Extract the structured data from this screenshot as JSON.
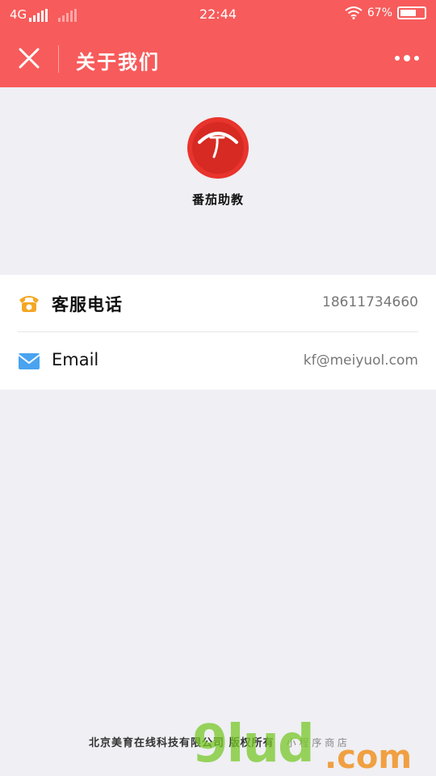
{
  "status_bar": {
    "network": "4G",
    "time": "22:44",
    "battery": "67%"
  },
  "nav": {
    "title": "关于我们"
  },
  "app": {
    "name": "番茄助教",
    "logo_icon": "tomato-logo-icon",
    "brand_color": "#f75b5b"
  },
  "contacts": [
    {
      "icon": "phone-icon",
      "label": "客服电话",
      "value": "18611734660",
      "icon_color": "#f5a623"
    },
    {
      "icon": "mail-icon",
      "label": "Email",
      "value": "kf@meiyuol.com",
      "icon_color": "#4aa3f0"
    }
  ],
  "footer": {
    "copyright": "北京美育在线科技有限公司 版权所有",
    "tag": "小 程 序 商 店",
    "watermark": "9lud",
    "watermark_suffix": ".com"
  }
}
